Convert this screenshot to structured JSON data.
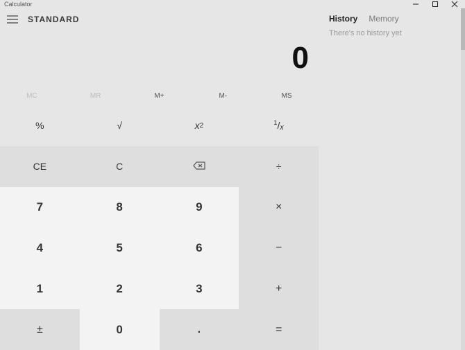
{
  "window": {
    "title": "Calculator"
  },
  "header": {
    "mode": "STANDARD"
  },
  "display": {
    "value": "0"
  },
  "memory": {
    "mc": "MC",
    "mr": "MR",
    "mplus": "M+",
    "mminus": "M-",
    "ms": "MS"
  },
  "keys": {
    "percent": "%",
    "sqrt": "√",
    "square_base": "x",
    "square_exp": "2",
    "recip_num": "1",
    "recip_slash": "/",
    "recip_x": "x",
    "ce": "CE",
    "c": "C",
    "divide": "÷",
    "multiply": "×",
    "minus": "−",
    "plus": "+",
    "equals": "=",
    "negate": "±",
    "decimal": ".",
    "n0": "0",
    "n1": "1",
    "n2": "2",
    "n3": "3",
    "n4": "4",
    "n5": "5",
    "n6": "6",
    "n7": "7",
    "n8": "8",
    "n9": "9"
  },
  "side": {
    "tab_history": "History",
    "tab_memory": "Memory",
    "empty_history": "There's no history yet"
  }
}
